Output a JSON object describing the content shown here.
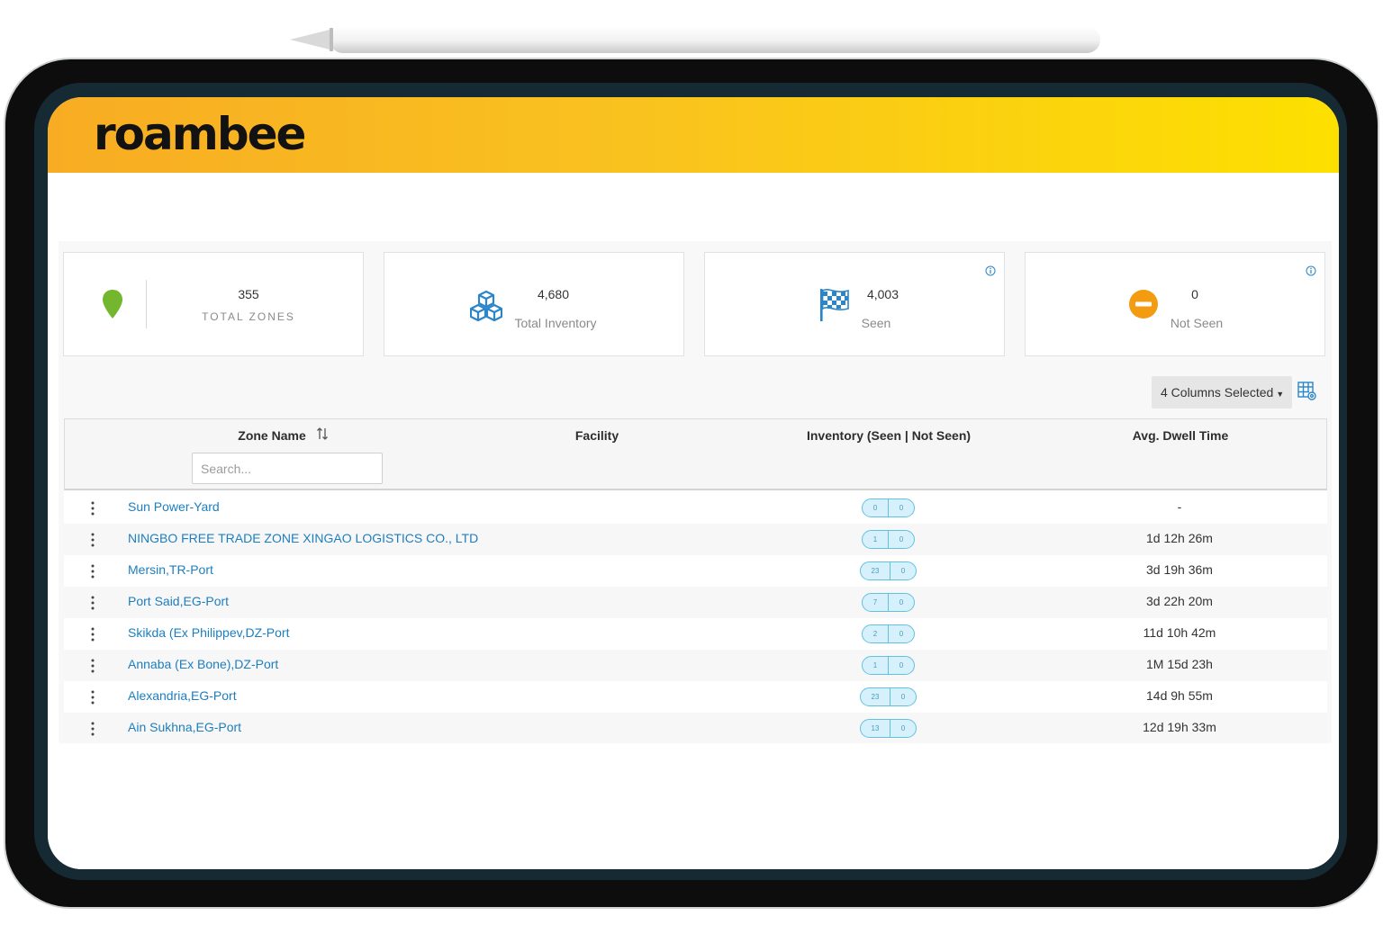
{
  "brand": {
    "logo_text": "roambee"
  },
  "stats": [
    {
      "value": "355",
      "label": "TOTAL ZONES",
      "icon": "map-pin-icon",
      "color": "#74b72e"
    },
    {
      "value": "4,680",
      "label": "Total Inventory",
      "icon": "boxes-icon",
      "color": "#2a86c9"
    },
    {
      "value": "4,003",
      "label": "Seen",
      "icon": "checkered-flag-icon",
      "color": "#2a86c9"
    },
    {
      "value": "0",
      "label": "Not Seen",
      "icon": "minus-circle-icon",
      "color": "#f39c12"
    }
  ],
  "toolbar": {
    "columns_label": "4 Columns Selected"
  },
  "table": {
    "columns": [
      "Zone Name",
      "Facility",
      "Inventory (Seen | Not Seen)",
      "Avg. Dwell Time"
    ],
    "search_placeholder": "Search...",
    "rows": [
      {
        "zone": "Sun Power-Yard",
        "seen": "0",
        "not_seen": "0",
        "dwell": "-"
      },
      {
        "zone": "NINGBO FREE TRADE ZONE XINGAO LOGISTICS CO., LTD",
        "seen": "1",
        "not_seen": "0",
        "dwell": "1d 12h 26m"
      },
      {
        "zone": "Mersin,TR-Port",
        "seen": "23",
        "not_seen": "0",
        "dwell": "3d 19h 36m"
      },
      {
        "zone": "Port Said,EG-Port",
        "seen": "7",
        "not_seen": "0",
        "dwell": "3d 22h 20m"
      },
      {
        "zone": "Skikda (Ex Philippev,DZ-Port",
        "seen": "2",
        "not_seen": "0",
        "dwell": "11d 10h 42m"
      },
      {
        "zone": "Annaba (Ex Bone),DZ-Port",
        "seen": "1",
        "not_seen": "0",
        "dwell": "1M 15d 23h"
      },
      {
        "zone": "Alexandria,EG-Port",
        "seen": "23",
        "not_seen": "0",
        "dwell": "14d 9h 55m"
      },
      {
        "zone": "Ain Sukhna,EG-Port",
        "seen": "13",
        "not_seen": "0",
        "dwell": "12d 19h 33m"
      }
    ]
  },
  "colors": {
    "header_start": "#f8ac23",
    "header_end": "#fde000",
    "link": "#1d7ebf",
    "pill_bg": "#d6f1fb"
  }
}
